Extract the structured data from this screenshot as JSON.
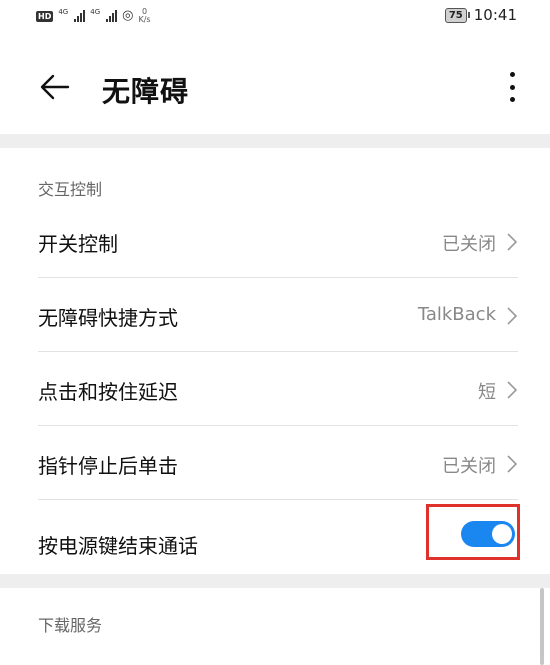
{
  "status_bar": {
    "hd_badge": "HD",
    "signal1_tag": "4G",
    "signal2_tag": "4G",
    "speed_value": "0",
    "speed_unit": "K/s",
    "battery": "75",
    "time": "10:41",
    "wifi_icon": "wifi-icon"
  },
  "header": {
    "back_icon": "back-arrow-icon",
    "title": "无障碍",
    "more_icon": "more-vertical-icon"
  },
  "sections": [
    {
      "title": "交互控制",
      "items": [
        {
          "label": "开关控制",
          "value": "已关闭"
        },
        {
          "label": "无障碍快捷方式",
          "value": "TalkBack"
        },
        {
          "label": "点击和按住延迟",
          "value": "短"
        },
        {
          "label": "指针停止后单击",
          "value": "已关闭"
        },
        {
          "label": "按电源键结束通话",
          "toggle": true
        }
      ]
    },
    {
      "title": "下载服务",
      "items": []
    }
  ],
  "colors": {
    "toggle_on": "#1a87f0",
    "highlight_border": "#e0322a",
    "separator": "#eeeeee"
  }
}
